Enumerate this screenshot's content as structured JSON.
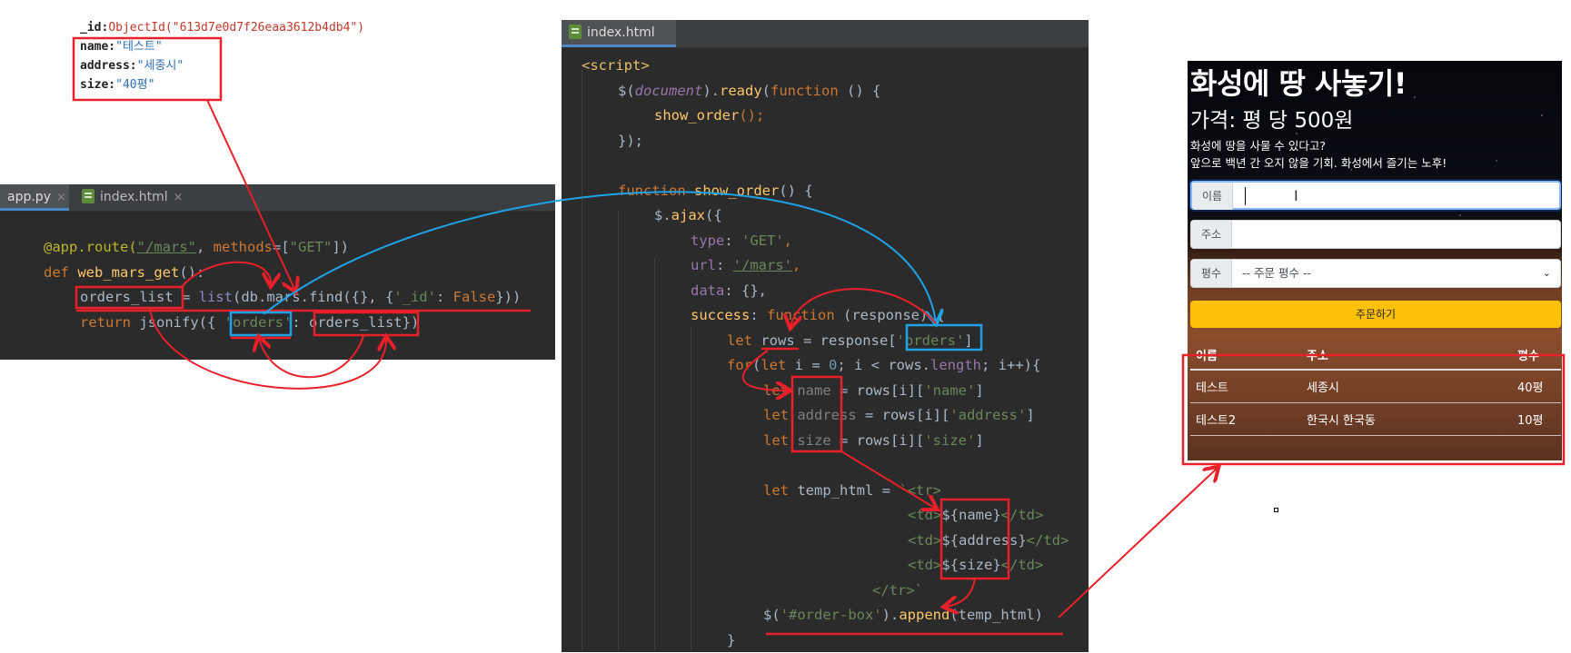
{
  "mongo_doc": {
    "id_key": "_id:",
    "id_value": "ObjectId(\"613d7e0d7f26eaa3612b4db4\")",
    "name_key": "name:",
    "name_value": "\"테스트\"",
    "address_key": "address:",
    "address_value": "\"세종시\"",
    "size_key": "size:",
    "size_value": "\"40평\""
  },
  "left_ide": {
    "tabs": [
      {
        "label": "app.py",
        "close": "×"
      },
      {
        "label": "index.html",
        "close": "×"
      }
    ],
    "line1": {
      "dec": "@app.route(",
      "path": "\"/mars\"",
      "comma": ", ",
      "methods": "methods",
      "eq": "=[",
      "get": "\"GET\"",
      "end": "])"
    },
    "line2": {
      "def": "def ",
      "name": "web_mars_get",
      "rest": "():"
    },
    "line3": {
      "var": "orders_list",
      "eq": " = ",
      "list": "list",
      "paren": "(db.",
      "mars": "mars",
      "find": ".find({}, {",
      "id": "'_id'",
      "colon": ": ",
      "false": "False",
      "end": "}))"
    },
    "line4": {
      "ret": "return ",
      "jsonify": "jsonify({ ",
      "orders": "'orders'",
      "colon": ": ",
      "var": "orders_list",
      "end": "})"
    }
  },
  "right_ide": {
    "tab": "index.html",
    "lines": {
      "l1": "<script>",
      "l2a": "$(",
      "l2b": "document",
      "l2c": ").",
      "l2d": "ready",
      "l2e": "(",
      "l2f": "function",
      "l2g": " () {",
      "l3a": "show_order",
      "l3b": "();",
      "l4": "});",
      "l5a": "function ",
      "l5b": "show_order",
      "l5c": "() {",
      "l6a": "$.",
      "l6b": "ajax",
      "l6c": "({",
      "l7a": "type",
      "l7b": ": ",
      "l7c": "'GET'",
      "l7d": ",",
      "l8a": "url",
      "l8b": ": ",
      "l8c": "'/mars'",
      "l8d": ",",
      "l9a": "data",
      "l9b": ": {},",
      "l10a": "success",
      "l10b": ": ",
      "l10c": "function ",
      "l10d": "(response) {",
      "l11a": "let ",
      "l11b": "rows",
      "l11c": " = response[",
      "l11d": "'orders'",
      "l11e": "]",
      "l12a": "for",
      "l12b": "(",
      "l12c": "let ",
      "l12d": "i = ",
      "l12e": "0",
      "l12f": "; i < rows.",
      "l12g": "length",
      "l12h": "; i++){",
      "l13a": "let ",
      "l13b": "name",
      "l13c": " = rows[i][",
      "l13d": "'name'",
      "l13e": "]",
      "l14a": "let ",
      "l14b": "address",
      "l14c": " = rows[i][",
      "l14d": "'address'",
      "l14e": "]",
      "l15a": "let ",
      "l15b": "size",
      "l15c": " = rows[i][",
      "l15d": "'size'",
      "l15e": "]",
      "l16a": "let ",
      "l16b": "temp_html = ",
      "l16c": "`<tr>",
      "l17a": "<td>",
      "l17b": "${name}",
      "l17c": "</td>",
      "l18a": "<td>",
      "l18b": "${address}",
      "l18c": "</td>",
      "l19a": "<td>",
      "l19b": "${size}",
      "l19c": "</td>",
      "l20": "</tr>`",
      "l21a": "$(",
      "l21b": "'#order-box'",
      "l21c": ").",
      "l21d": "append",
      "l21e": "(temp_html)",
      "l22": "}"
    }
  },
  "mars_page": {
    "title": "화성에 땅 사놓기!",
    "price": "가격: 평 당 500원",
    "desc1": "화성에 땅을 사물 수 있다고?",
    "desc2": "앞으로 백년 간 오지 않을 기회. 화성에서 즐기는 노후!",
    "name_label": "이름",
    "address_label": "주소",
    "size_label": "평수",
    "size_placeholder": "-- 주문 평수 --",
    "order_button": "주문하기",
    "table": {
      "headers": [
        "이름",
        "주소",
        "평수"
      ],
      "rows": [
        [
          "테스트",
          "세종시",
          "40평"
        ],
        [
          "테스트2",
          "한국시 한국동",
          "10평"
        ]
      ]
    }
  },
  "colors": {
    "annotation_red": "#e8202a",
    "annotation_blue": "#1ea3e6",
    "ide_bg": "#2b2b2b",
    "button_yellow": "#ffc107"
  }
}
